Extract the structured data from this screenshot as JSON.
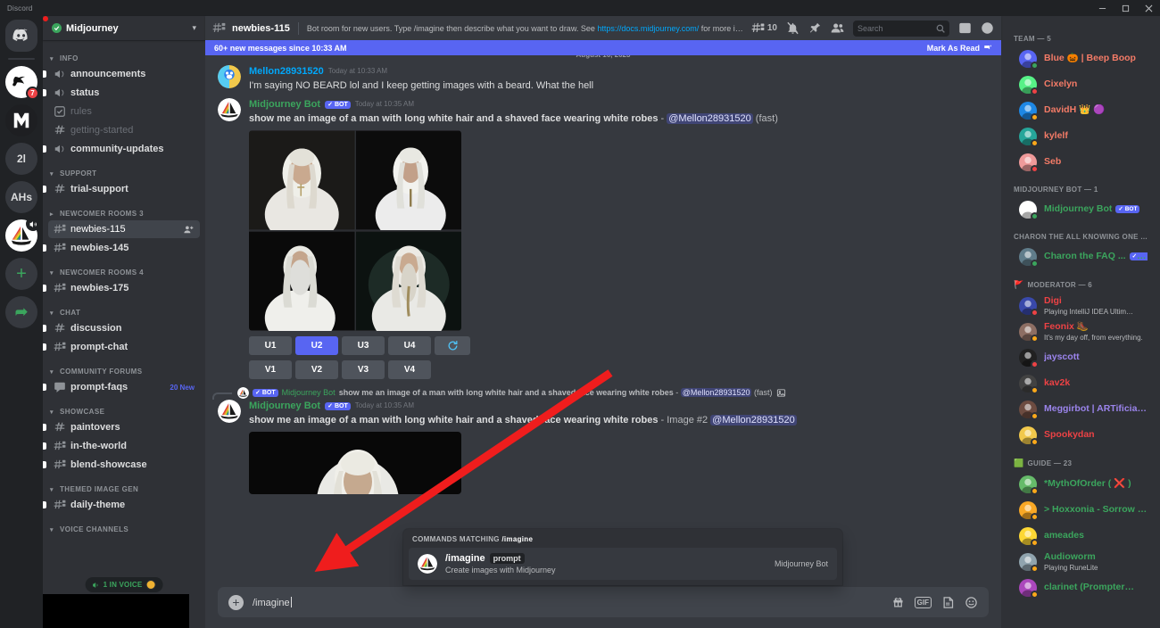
{
  "titlebar": {
    "app_label": "Discord",
    "minimize": "minimize-icon",
    "maximize": "maximize-icon",
    "close": "close-icon"
  },
  "guild_rail": {
    "items": [
      {
        "name": "home",
        "label": "",
        "badge": ""
      },
      {
        "name": "midjourney-alt",
        "label": "",
        "badge": "7"
      },
      {
        "name": "server-m",
        "label": "",
        "badge": ""
      },
      {
        "name": "server-2l",
        "label": "2l",
        "badge": ""
      },
      {
        "name": "server-ahs",
        "label": "AHs",
        "badge": ""
      },
      {
        "name": "midjourney",
        "label": "",
        "badge": ""
      }
    ],
    "add_server": "+",
    "explore": "compass-icon"
  },
  "sidebar": {
    "server_name": "Midjourney",
    "verified": true,
    "categories": [
      {
        "name": "INFO",
        "collapsed": false,
        "channels": [
          {
            "label": "announcements",
            "icon": "announcement-icon",
            "state": "unread"
          },
          {
            "label": "status",
            "icon": "announcement-icon",
            "state": "unread"
          },
          {
            "label": "rules",
            "icon": "rules-icon",
            "state": "muted"
          },
          {
            "label": "getting-started",
            "icon": "hash-icon",
            "state": "muted"
          },
          {
            "label": "community-updates",
            "icon": "announcement-icon",
            "state": "unread"
          }
        ]
      },
      {
        "name": "SUPPORT",
        "collapsed": false,
        "channels": [
          {
            "label": "trial-support",
            "icon": "hash-icon",
            "state": "unread"
          }
        ]
      },
      {
        "name": "NEWCOMER ROOMS 3",
        "collapsed": true,
        "highlighted": true,
        "channels": [
          {
            "label": "newbies-115",
            "icon": "hash-thread-icon",
            "state": "active",
            "trailing": "invite-icon"
          },
          {
            "label": "newbies-145",
            "icon": "hash-thread-icon",
            "state": "unread"
          }
        ]
      },
      {
        "name": "NEWCOMER ROOMS 4",
        "collapsed": false,
        "channels": [
          {
            "label": "newbies-175",
            "icon": "hash-thread-icon",
            "state": "unread"
          }
        ]
      },
      {
        "name": "CHAT",
        "collapsed": false,
        "channels": [
          {
            "label": "discussion",
            "icon": "hash-icon",
            "state": "unread"
          },
          {
            "label": "prompt-chat",
            "icon": "hash-thread-icon",
            "state": "unread"
          }
        ]
      },
      {
        "name": "COMMUNITY FORUMS",
        "collapsed": false,
        "channels": [
          {
            "label": "prompt-faqs",
            "icon": "forum-icon",
            "state": "unread",
            "badge": "20 New"
          }
        ]
      },
      {
        "name": "SHOWCASE",
        "collapsed": false,
        "channels": [
          {
            "label": "paintovers",
            "icon": "hash-icon",
            "state": "unread"
          },
          {
            "label": "in-the-world",
            "icon": "hash-thread-icon",
            "state": "unread"
          },
          {
            "label": "blend-showcase",
            "icon": "hash-thread-icon",
            "state": "unread"
          }
        ]
      },
      {
        "name": "THEMED IMAGE GEN",
        "collapsed": false,
        "channels": [
          {
            "label": "daily-theme",
            "icon": "hash-thread-icon",
            "state": "unread"
          }
        ]
      },
      {
        "name": "VOICE CHANNELS",
        "collapsed": false,
        "channels": []
      }
    ],
    "voice_pill": {
      "label": "1 IN VOICE"
    }
  },
  "channel_header": {
    "icon": "hash-thread-icon",
    "name": "newbies-115",
    "topic_before": "Bot room for new users. Type /imagine then describe what you want to draw. See ",
    "topic_link": "https://docs.midjourney.com/",
    "topic_after": " for more information",
    "threads_count": "10",
    "icons": [
      "threads-icon",
      "notifications-off-icon",
      "pin-icon",
      "members-icon"
    ],
    "search_placeholder": "Search",
    "inbox_icon": "inbox-icon",
    "help_icon": "help-icon"
  },
  "new_messages_bar": {
    "text": "60+ new messages since 10:33 AM",
    "mark_label": "Mark As Read"
  },
  "messages": {
    "date_divider": "August 16, 2023",
    "items": [
      {
        "author": "Mellon28931520",
        "author_color": "blue",
        "timestamp": "Today at 10:33 AM",
        "bot": false,
        "text": "I'm saying NO BEARD lol and I keep getting images with a beard. What the hell"
      },
      {
        "author": "Midjourney Bot",
        "author_color": "green",
        "bot_tag": "BOT",
        "timestamp": "Today at 10:35 AM",
        "bot": true,
        "prompt": "show me an image of a man with long white hair and a shaved face wearing white robes",
        "separator": " - ",
        "mention": "@Mellon28931520",
        "suffix": " (fast)",
        "has_grid": true,
        "upscale_buttons": [
          "U1",
          "U2",
          "U3",
          "U4"
        ],
        "selected_button": "U2",
        "reroll_icon": "reroll-icon",
        "variation_buttons": [
          "V1",
          "V2",
          "V3",
          "V4"
        ]
      },
      {
        "reply_ref": {
          "bot_tag": "BOT",
          "author": "Midjourney Bot",
          "text_bold": "show me an image of a man with long white hair and a shaved face wearing white robes",
          "separator": " - ",
          "mention": "@Mellon28931520",
          "suffix": " (fast)",
          "attachment_icon": "image-icon"
        },
        "author": "Midjourney Bot",
        "author_color": "green",
        "bot_tag": "BOT",
        "timestamp": "Today at 10:35 AM",
        "bot": true,
        "prompt": "show me an image of a man with long white hair and a shaved face wearing white robes",
        "separator": " - ",
        "image_label": "Image #2",
        "mention": "@Mellon28931520",
        "has_single_image": true
      }
    ]
  },
  "command_popup": {
    "header_prefix": "COMMANDS MATCHING ",
    "header_cmd": "/imagine",
    "command": "/imagine",
    "arg": "prompt",
    "description": "Create images with Midjourney",
    "app_name": "Midjourney Bot"
  },
  "input_bar": {
    "value": "/imagine",
    "plus_icon": "plus-icon",
    "gift_icon": "gift-icon",
    "gif_label": "GIF",
    "sticker_icon": "sticker-icon",
    "emoji_icon": "emoji-icon"
  },
  "members": {
    "groups": [
      {
        "title": "TEAM — 5",
        "role_icon": "",
        "people": [
          {
            "name": "Blue 🎃 | Beep Boop",
            "color": "#f47b67",
            "status": "online",
            "sub": "",
            "device": "mobile"
          },
          {
            "name": "Cixelyn",
            "color": "#f47b67",
            "status": "dnd",
            "sub": ""
          },
          {
            "name": "DavidH 👑 🟣",
            "color": "#f47b67",
            "status": "idle",
            "sub": ""
          },
          {
            "name": "kylelf",
            "color": "#f47b67",
            "status": "idle",
            "sub": ""
          },
          {
            "name": "Seb",
            "color": "#f47b67",
            "status": "dnd",
            "sub": ""
          }
        ]
      },
      {
        "title": "MIDJOURNEY BOT — 1",
        "people": [
          {
            "name": "Midjourney Bot",
            "color": "#3ba55d",
            "status": "online",
            "bot": "BOT",
            "sub": ""
          }
        ]
      },
      {
        "title": "CHARON THE ALL KNOWING ONE ...",
        "people": [
          {
            "name": "Charon the FAQ ...",
            "color": "#3ba55d",
            "status": "online",
            "bot": "BOT",
            "sub": ""
          }
        ]
      },
      {
        "title": "MODERATOR — 6",
        "role_icon": "🚩",
        "people": [
          {
            "name": "Digi",
            "color": "#ed4245",
            "status": "dnd",
            "sub": "Playing IntelliJ IDEA Ultim…"
          },
          {
            "name": "Feonix 🥾",
            "color": "#ed4245",
            "status": "idle",
            "sub": "It's my day off, from everything."
          },
          {
            "name": "jayscott",
            "color": "#9b84ec",
            "status": "dnd",
            "sub": ""
          },
          {
            "name": "kav2k",
            "color": "#ed4245",
            "status": "idle",
            "sub": ""
          },
          {
            "name": "Meggirbot | ARTificial…",
            "color": "#9b84ec",
            "status": "idle",
            "sub": ""
          },
          {
            "name": "Spookydan",
            "color": "#ed4245",
            "status": "idle",
            "sub": ""
          }
        ]
      },
      {
        "title": "GUIDE — 23",
        "role_icon": "🟩",
        "people": [
          {
            "name": "*MythOfOrder ( ❌ )",
            "color": "#3ba55d",
            "status": "idle",
            "sub": ""
          },
          {
            "name": "> Hoxxonia - Sorrow …",
            "color": "#3ba55d",
            "status": "idle",
            "sub": ""
          },
          {
            "name": "ameades",
            "color": "#3ba55d",
            "status": "idle",
            "sub": ""
          },
          {
            "name": "Audioworm",
            "color": "#3ba55d",
            "status": "idle",
            "sub": "Playing RuneLite"
          },
          {
            "name": "clarinet (Prompter…",
            "color": "#3ba55d",
            "status": "idle",
            "sub": ""
          }
        ]
      }
    ]
  },
  "annotations": {
    "red_box": "highlight-newcomer-rooms-3",
    "red_arrow": "pointer-to-imagine-command",
    "accent": "#ef1d1d"
  }
}
